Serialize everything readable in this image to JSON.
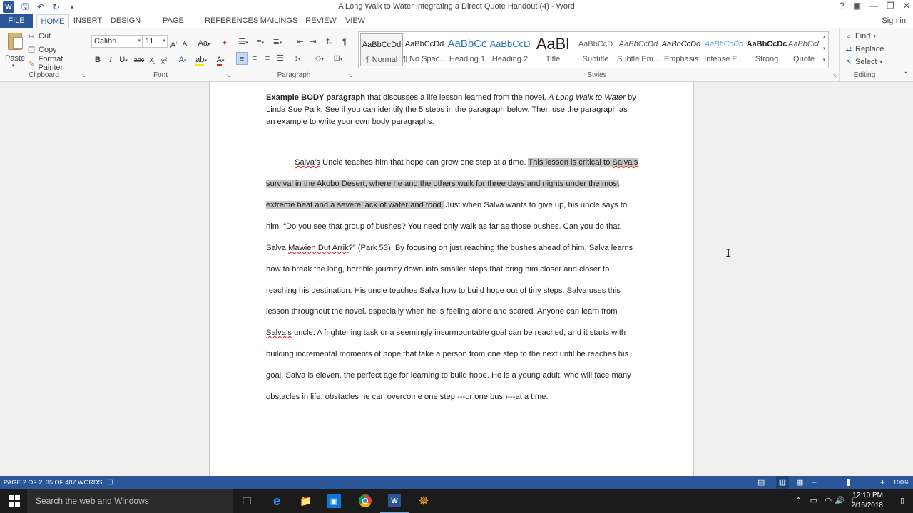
{
  "window": {
    "title": "A Long Walk to Water Integrating a Direct Quote Handout (4) - Word",
    "controls": [
      "?",
      "▣",
      "—",
      "❐",
      "✕"
    ]
  },
  "tabs": [
    {
      "label": "FILE"
    },
    {
      "label": "HOME"
    },
    {
      "label": "INSERT"
    },
    {
      "label": "DESIGN"
    },
    {
      "label": "PAGE LAYOUT"
    },
    {
      "label": "REFERENCES"
    },
    {
      "label": "MAILINGS"
    },
    {
      "label": "REVIEW"
    },
    {
      "label": "VIEW"
    }
  ],
  "signin": "Sign in",
  "clipboard": {
    "paste": "Paste",
    "cut": "Cut",
    "copy": "Copy",
    "format_painter": "Format Painter",
    "label": "Clipboard"
  },
  "font": {
    "name": "Calibri",
    "size": "11",
    "label": "Font"
  },
  "paragraph": {
    "label": "Paragraph"
  },
  "styles": {
    "label": "Styles",
    "items": [
      {
        "preview": "AaBbCcDd",
        "name": "¶ Normal"
      },
      {
        "preview": "AaBbCcDd",
        "name": "¶ No Spac..."
      },
      {
        "preview": "AaBbCc",
        "name": "Heading 1"
      },
      {
        "preview": "AaBbCcD",
        "name": "Heading 2"
      },
      {
        "preview": "AaBl",
        "name": "Title"
      },
      {
        "preview": "AaBbCcD",
        "name": "Subtitle"
      },
      {
        "preview": "AaBbCcDd",
        "name": "Subtle Em..."
      },
      {
        "preview": "AaBbCcDd",
        "name": "Emphasis"
      },
      {
        "preview": "AaBbCcDd",
        "name": "Intense E..."
      },
      {
        "preview": "AaBbCcDc",
        "name": "Strong"
      },
      {
        "preview": "AaBbCcDd",
        "name": "Quote"
      }
    ]
  },
  "editing": {
    "find": "Find",
    "replace": "Replace",
    "select": "Select",
    "label": "Editing"
  },
  "document": {
    "intro_bold": "Example BODY paragraph",
    "intro_a": " that discusses a life lesson learned from the novel, ",
    "intro_italic": "A Long Walk to Water",
    "intro_b": " by Linda Sue Park. See if you can identify the 5 steps in the paragraph below. Then use the paragraph as an example to write your own body paragraphs.",
    "l1_a": "Salva’s",
    "l1_b": " Uncle teaches him that hope can grow one step at a time. ",
    "l1_c": "This lesson is critical to ",
    "l1_d": "Salva’s",
    "l2": "survival in the Akobo Desert, where he and the others walk for three days and nights under the most",
    "l3_a": "extreme heat and a severe lack of water and food.",
    "l3_b": " Just when Salva wants to give up, his uncle says to",
    "l4": "him, “Do you see that group of bushes? You need only walk as far as those bushes. Can you do that,",
    "l5_a": "Salva ",
    "l5_b": "Mawien Dut Arrik",
    "l5_c": "?” (Park 53).  By focusing on just reaching the bushes ahead of him, Salva learns",
    "l6": "how to break the long, horrible journey down into smaller steps that bring him closer and closer to",
    "l7": "reaching his destination. His uncle teaches Salva how to build hope out of tiny steps. Salva uses this",
    "l8": "lesson throughout the novel, especially when he is feeling alone and scared. Anyone can learn from",
    "l9_a": "Salva’s",
    "l9_b": " uncle. A frightening task or a seemingly insurmountable goal can be reached, and it starts with",
    "l10": "building incremental moments of hope that take a person from one step to the next until he reaches his",
    "l11": "goal. Salva is eleven, the perfect age for learning to build hope. He is a young adult, who will face many",
    "l12": "obstacles in life, obstacles he can overcome one step ---or one bush---at a time."
  },
  "status": {
    "page": "PAGE 2 OF 2",
    "words": "35 OF 487 WORDS",
    "zoom": "100%",
    "zoom_level": 1.0
  },
  "taskbar": {
    "search_placeholder": "Search the web and Windows",
    "time": "12:10 PM",
    "date": "2/16/2018"
  },
  "colors": {
    "accent": "#2b579a",
    "selection": "#c8c8c8"
  }
}
